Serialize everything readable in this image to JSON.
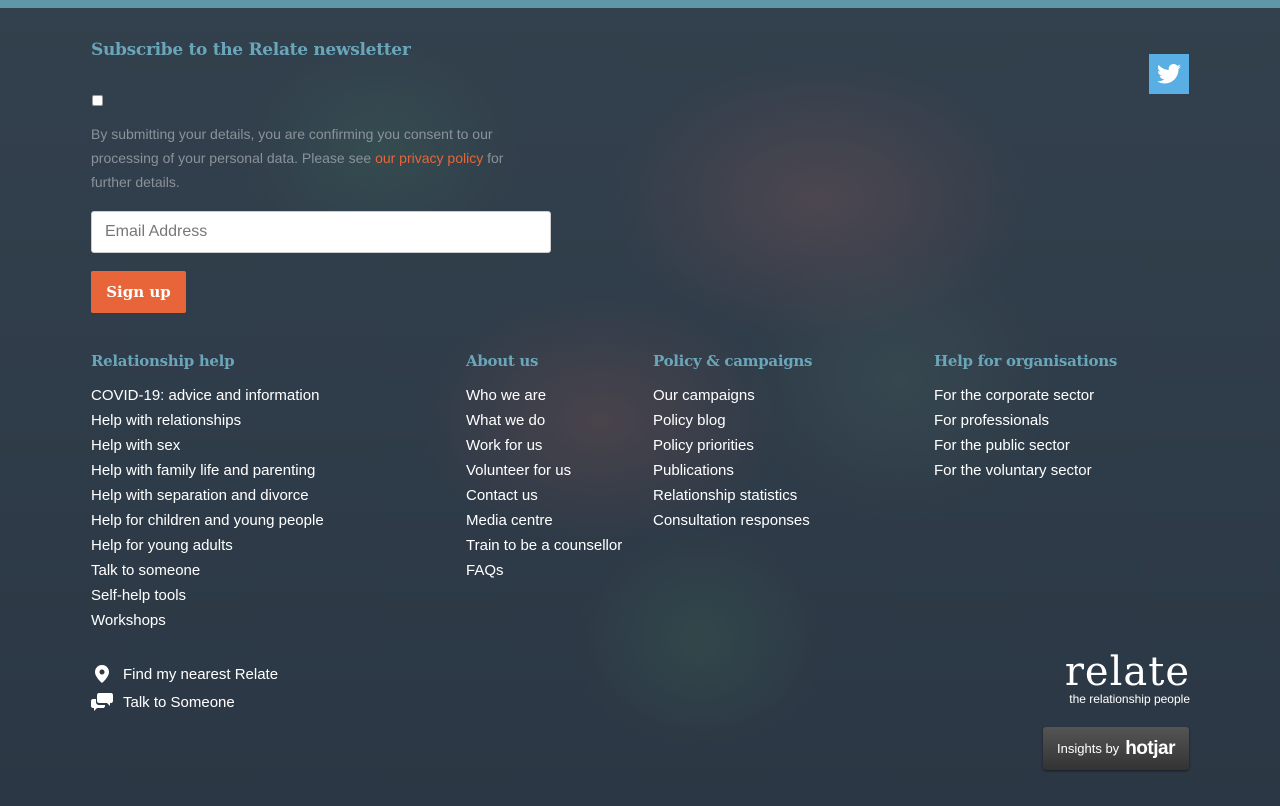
{
  "newsletter": {
    "title": "Subscribe to the Relate newsletter",
    "consent_before": "By submitting your details, you are confirming you consent to our processing of your personal data. Please see ",
    "consent_link": "our privacy policy",
    "consent_after": " for further details.",
    "email_placeholder": "Email Address",
    "signup_label": "Sign up"
  },
  "columns": [
    {
      "heading": "Relationship help",
      "items": [
        "COVID-19: advice and information",
        "Help with relationships",
        "Help with sex",
        "Help with family life and parenting",
        "Help with separation and divorce",
        "Help for children and young people",
        "Help for young adults",
        "Talk to someone",
        "Self-help tools",
        "Workshops"
      ]
    },
    {
      "heading": "About us",
      "items": [
        "Who we are",
        "What we do",
        "Work for us",
        "Volunteer for us",
        "Contact us",
        "Media centre",
        "Train to be a counsellor",
        "FAQs"
      ]
    },
    {
      "heading": "Policy & campaigns",
      "items": [
        "Our campaigns",
        "Policy blog",
        "Policy priorities",
        "Publications",
        "Relationship statistics",
        "Consultation responses"
      ]
    },
    {
      "heading": "Help for organisations",
      "items": [
        "For the corporate sector",
        "For professionals",
        "For the public sector",
        "For the voluntary sector"
      ]
    }
  ],
  "quick_links": {
    "find": "Find my nearest Relate",
    "talk": "Talk to Someone"
  },
  "logo": {
    "word": "relate",
    "tagline": "the relationship people"
  },
  "hotjar": {
    "prefix": "Insights by",
    "brand": "hotjar"
  },
  "icons": {
    "twitter": "twitter-icon",
    "location": "location-pin-icon",
    "chat": "chat-bubbles-icon"
  },
  "colors": {
    "accent_teal": "#6aa6b9",
    "accent_orange": "#e8653a",
    "twitter_blue": "#59aee3"
  }
}
